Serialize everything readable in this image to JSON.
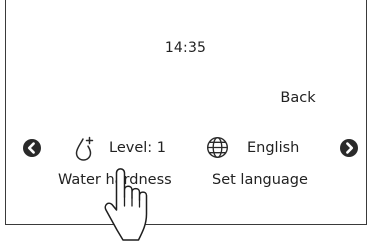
{
  "status_bar": {
    "time": "14:35"
  },
  "header": {
    "back_label": "Back"
  },
  "tiles": [
    {
      "icon": "water-drop-plus-icon",
      "value": "Level: 1",
      "label": "Water hardness"
    },
    {
      "icon": "globe-icon",
      "value": "English",
      "label": "Set language"
    }
  ],
  "navigation": {
    "prev_icon": "chevron-left-circle-icon",
    "next_icon": "chevron-right-circle-icon"
  },
  "overlay": {
    "icon": "tap-hand-icon"
  },
  "colors": {
    "text": "#222222",
    "frame": "#3a3a3a",
    "background": "#ffffff"
  }
}
